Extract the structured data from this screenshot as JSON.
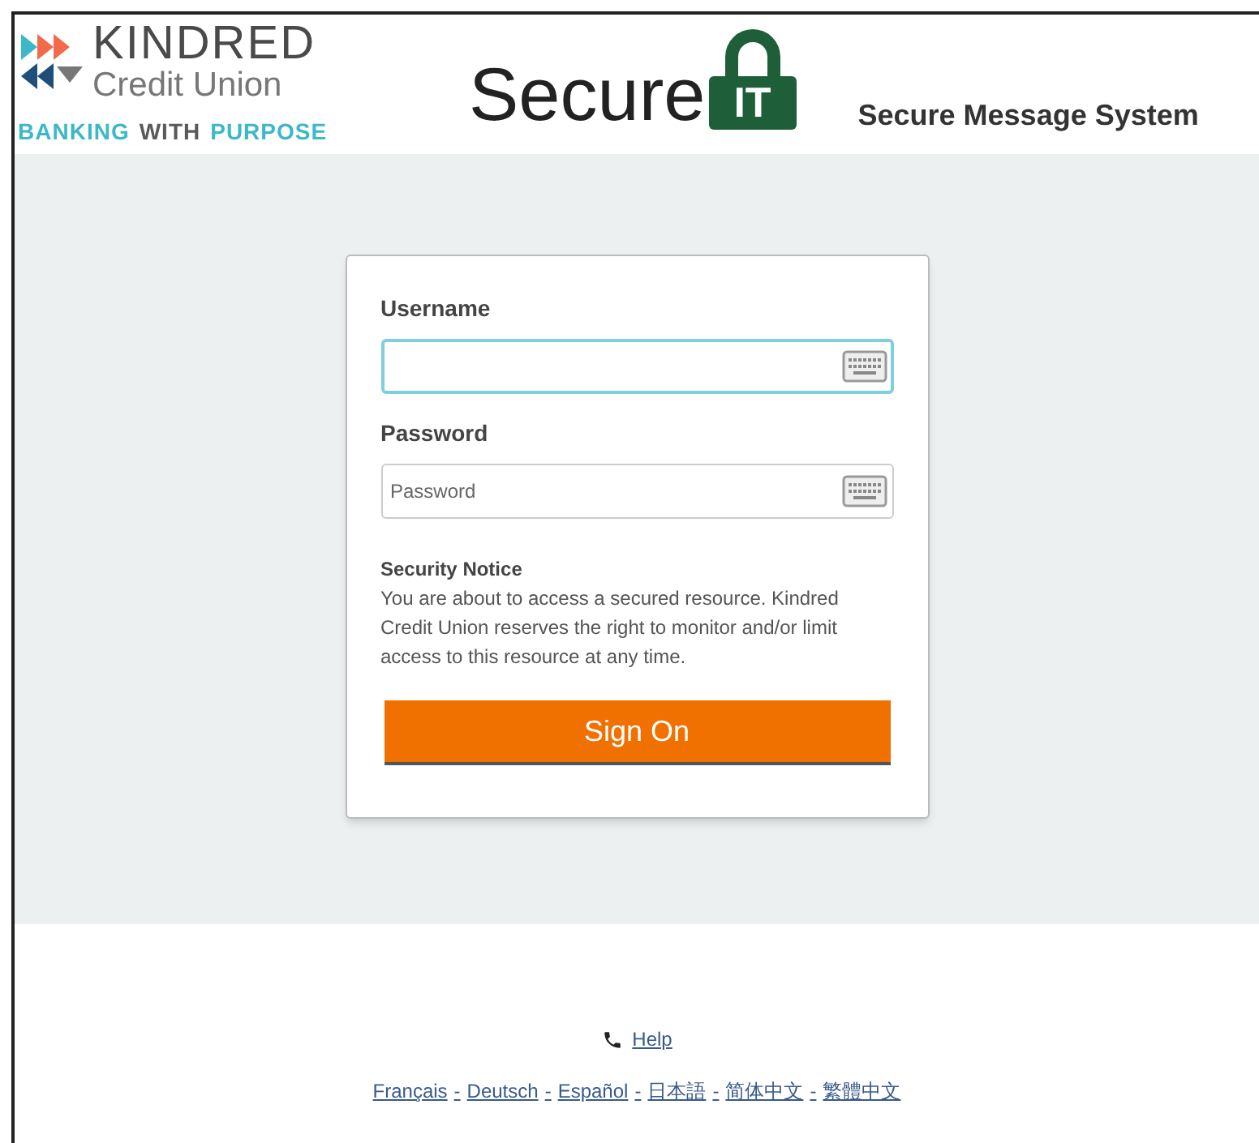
{
  "brand": {
    "name": "KINDRED",
    "subtitle": "Credit Union",
    "tagline": [
      {
        "text": "BANKING",
        "color": "#3db8c8"
      },
      {
        "text": "WITH",
        "color": "#5a5a5a"
      },
      {
        "text": "PURPOSE",
        "color": "#3db8c8"
      }
    ]
  },
  "product": {
    "word": "Secure",
    "lock_text": "IT",
    "title": "Secure Message System"
  },
  "form": {
    "username": {
      "label": "Username",
      "focused": true
    },
    "password": {
      "label": "Password",
      "placeholder": "Password",
      "focused": false
    },
    "notice": {
      "title": "Security Notice",
      "text": "You are about to access a secured resource. Kindred Credit Union reserves the right to monitor and/or limit access to this resource at any time."
    },
    "submit": "Sign On"
  },
  "footer": {
    "help": "Help",
    "languages": [
      "Français",
      "Deutsch",
      "Español",
      "日本語",
      "简体中文",
      "繁體中文"
    ],
    "separator": "-"
  }
}
